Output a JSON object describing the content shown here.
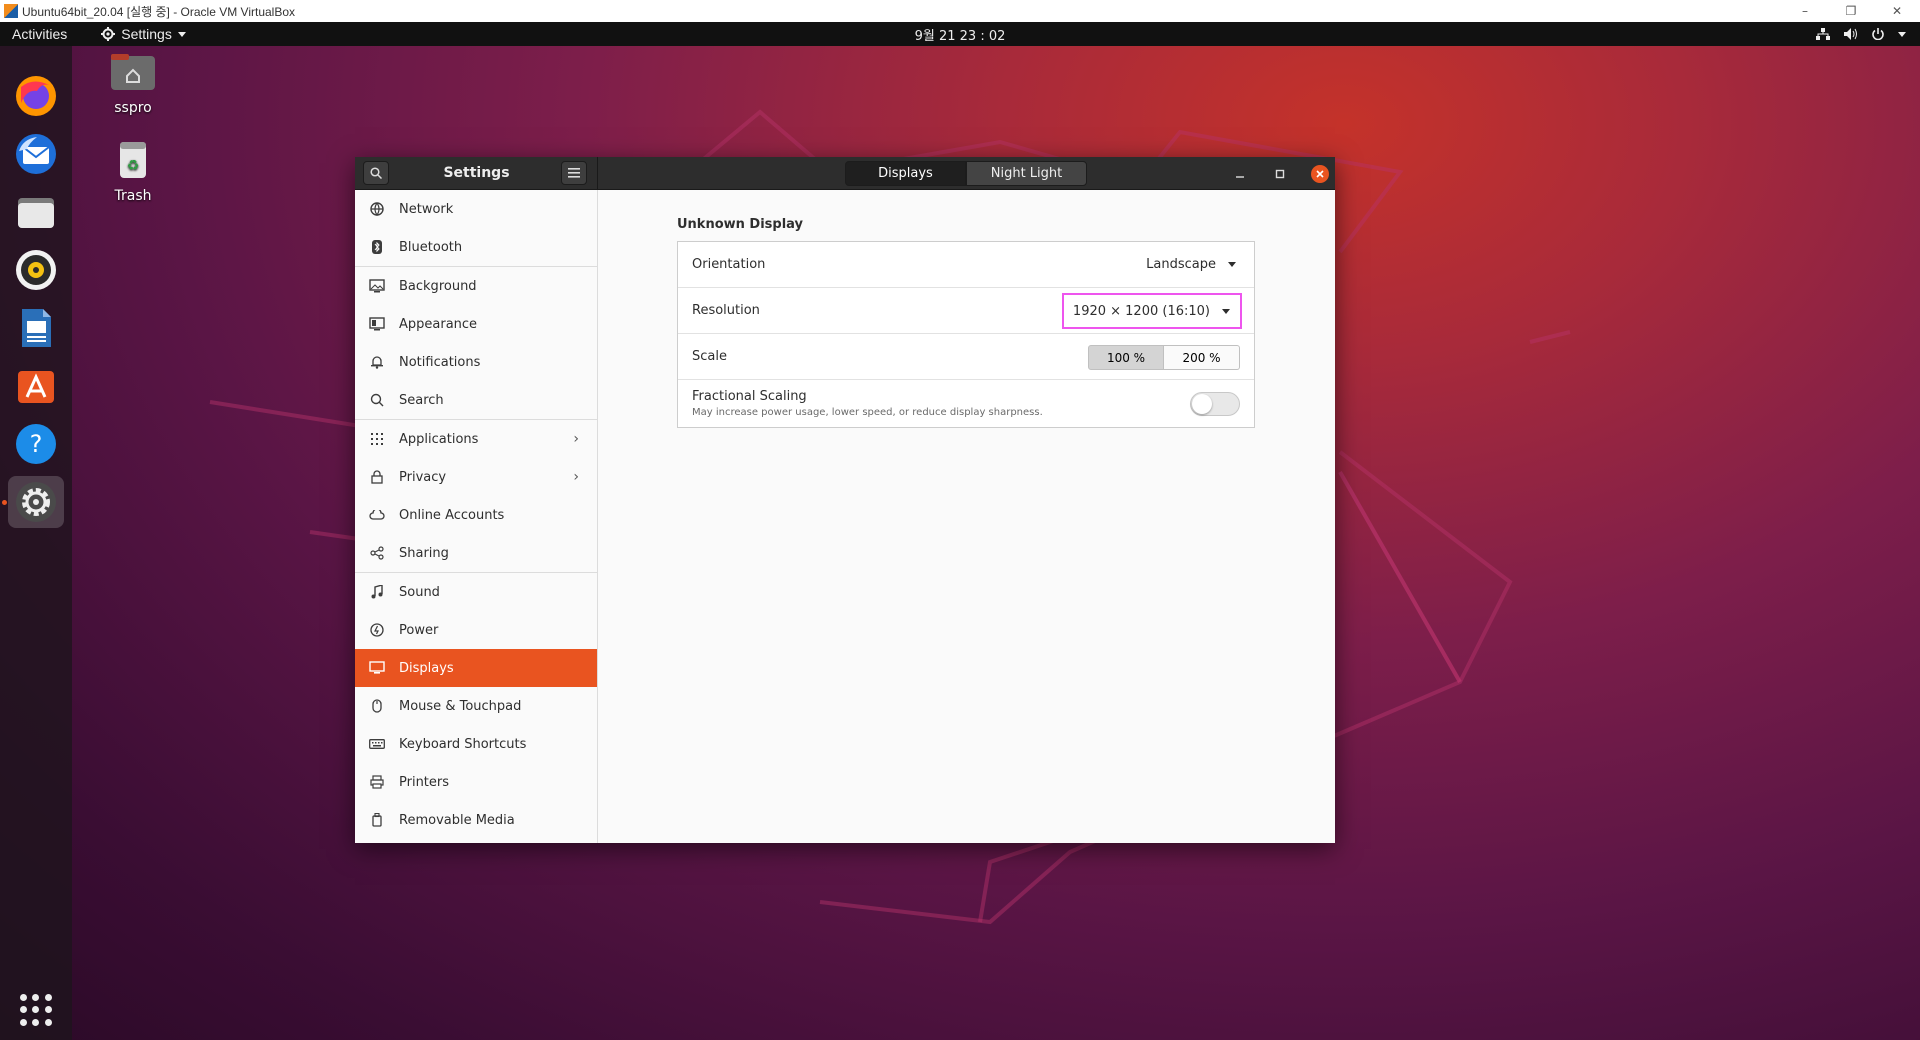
{
  "host": {
    "title": "Ubuntu64bit_20.04 [실행 중] - Oracle VM VirtualBox",
    "minimize": "–",
    "restore": "❐",
    "close": "✕"
  },
  "top_panel": {
    "activities": "Activities",
    "app_menu": "Settings",
    "clock": "9월 21  23 : 02"
  },
  "dock": {
    "items": [
      {
        "name": "Firefox",
        "icon": "firefox-icon"
      },
      {
        "name": "Thunderbird",
        "icon": "thunderbird-icon"
      },
      {
        "name": "Files",
        "icon": "files-icon"
      },
      {
        "name": "Rhythmbox",
        "icon": "rhythmbox-icon"
      },
      {
        "name": "LibreOffice Writer",
        "icon": "writer-icon"
      },
      {
        "name": "Ubuntu Software",
        "icon": "software-icon"
      },
      {
        "name": "Help",
        "icon": "help-icon"
      },
      {
        "name": "Settings",
        "icon": "settings-gear-icon",
        "active": true
      }
    ]
  },
  "desktop": {
    "icons": [
      {
        "label": "sspro"
      },
      {
        "label": "Trash"
      }
    ]
  },
  "settings": {
    "sidebar_title": "Settings",
    "tabs": [
      "Displays",
      "Night Light"
    ],
    "sidebar": {
      "items": [
        {
          "label": "Network",
          "icon": "network-icon"
        },
        {
          "label": "Bluetooth",
          "icon": "bluetooth-icon"
        },
        {
          "label": "Background",
          "icon": "background-icon"
        },
        {
          "label": "Appearance",
          "icon": "appearance-icon"
        },
        {
          "label": "Notifications",
          "icon": "bell-icon"
        },
        {
          "label": "Search",
          "icon": "search-icon"
        },
        {
          "label": "Applications",
          "icon": "apps-grid-icon",
          "has_arrow": true
        },
        {
          "label": "Privacy",
          "icon": "lock-icon",
          "has_arrow": true
        },
        {
          "label": "Online Accounts",
          "icon": "cloud-icon"
        },
        {
          "label": "Sharing",
          "icon": "share-icon"
        },
        {
          "label": "Sound",
          "icon": "music-note-icon"
        },
        {
          "label": "Power",
          "icon": "power-icon"
        },
        {
          "label": "Displays",
          "icon": "display-icon",
          "active": true
        },
        {
          "label": "Mouse & Touchpad",
          "icon": "mouse-icon"
        },
        {
          "label": "Keyboard Shortcuts",
          "icon": "keyboard-icon"
        },
        {
          "label": "Printers",
          "icon": "printer-icon"
        },
        {
          "label": "Removable Media",
          "icon": "removable-media-icon"
        }
      ]
    },
    "display": {
      "title": "Unknown Display",
      "orientation_label": "Orientation",
      "orientation_value": "Landscape",
      "resolution_label": "Resolution",
      "resolution_value": "1920 × 1200 (16:10)",
      "scale_label": "Scale",
      "scale_options": [
        "100 %",
        "200 %"
      ],
      "scale_selected": "100 %",
      "fractional_label": "Fractional Scaling",
      "fractional_sub": "May increase power usage, lower speed, or reduce display sharpness.",
      "fractional_enabled": false
    }
  },
  "colors": {
    "accent": "#e95420",
    "highlight_outline": "#ee55ee"
  }
}
